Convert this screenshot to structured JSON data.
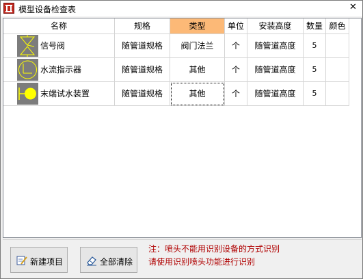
{
  "window": {
    "title": "模型设备检查表",
    "close_glyph": "✕"
  },
  "columns": [
    {
      "key": "name",
      "label": "名称"
    },
    {
      "key": "spec",
      "label": "规格"
    },
    {
      "key": "type",
      "label": "类型",
      "selected": true
    },
    {
      "key": "unit",
      "label": "单位"
    },
    {
      "key": "height",
      "label": "安装高度"
    },
    {
      "key": "qty",
      "label": "数量"
    },
    {
      "key": "color",
      "label": "颜色"
    }
  ],
  "rows": [
    {
      "icon": "signal-valve-icon",
      "name": "信号阀",
      "spec": "随管道规格",
      "type": "阀门法兰",
      "unit": "个",
      "height": "随管道高度",
      "qty": "5",
      "color": ""
    },
    {
      "icon": "water-flow-indicator-icon",
      "name": "水流指示器",
      "spec": "随管道规格",
      "type": "其他",
      "unit": "个",
      "height": "随管道高度",
      "qty": "5",
      "color": ""
    },
    {
      "icon": "end-test-water-device-icon",
      "name": "末端试水装置",
      "spec": "随管道规格",
      "type": "其他",
      "unit": "个",
      "height": "随管道高度",
      "qty": "5",
      "color": ""
    }
  ],
  "buttons": {
    "new_item": {
      "label": "新建项目",
      "icon": "edit-icon"
    },
    "clear_all": {
      "label": "全部清除",
      "icon": "eraser-icon"
    }
  },
  "note": {
    "line1": "注：喷头不能用识别设备的方式识别",
    "line2": "请使用识别喷头功能进行识别"
  },
  "colors": {
    "selected_header": "#fcb977",
    "symbol_bg": "#7c7c7c",
    "symbol_stroke": "#ffff00",
    "note_text": "#b00000"
  }
}
